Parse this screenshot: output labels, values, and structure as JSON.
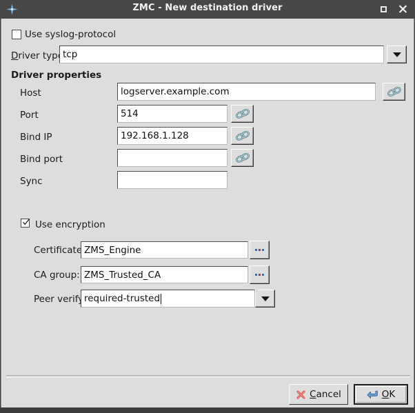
{
  "window": {
    "title": "ZMC - New destination driver",
    "app_icon": "zmc-star-icon",
    "controls": {
      "maximize": "maximize-icon",
      "close": "close-icon"
    }
  },
  "form": {
    "syslog_checkbox": {
      "label": "Use syslog-protocol",
      "checked": false
    },
    "driver_type": {
      "label": "Driver type:",
      "accelerator": "D",
      "value": "tcp",
      "dropdown_icon": "chevron-down-icon"
    },
    "section_heading": "Driver properties",
    "properties": [
      {
        "label": "Host",
        "value": "logserver.example.com",
        "has_link": true,
        "wide": true
      },
      {
        "label": "Port",
        "value": "514",
        "has_link": true,
        "wide": false
      },
      {
        "label": "Bind IP",
        "value": "192.168.1.128",
        "has_link": true,
        "wide": false
      },
      {
        "label": "Bind port",
        "value": "",
        "has_link": true,
        "wide": false
      },
      {
        "label": "Sync",
        "value": "",
        "has_link": false,
        "wide": false
      }
    ],
    "link_icon": "chain-link-icon",
    "encryption_checkbox": {
      "label": "Use encryption",
      "checked": true
    },
    "encryption": [
      {
        "label": "Certificate:",
        "value": "ZMS_Engine",
        "button": "..."
      },
      {
        "label": "CA group:",
        "value": "ZMS_Trusted_CA",
        "button": "..."
      }
    ],
    "peer_verify": {
      "label": "Peer verify:",
      "value": "required-trusted",
      "dropdown_icon": "chevron-down-icon",
      "focused": true
    }
  },
  "footer": {
    "cancel": {
      "label": "Cancel",
      "accelerator": "C",
      "icon": "red-x-icon"
    },
    "ok": {
      "label": "OK",
      "accelerator": "O",
      "icon": "enter-arrow-icon",
      "default": true
    }
  },
  "colors": {
    "titlebar": "#474747",
    "dialog_bg": "#dddddd",
    "field_bg": "#ffffff",
    "text": "#1b1b1b",
    "cancel_icon": "#e05050",
    "ok_icon": "#5b8fc9",
    "link_icon": "#5f8e94"
  }
}
